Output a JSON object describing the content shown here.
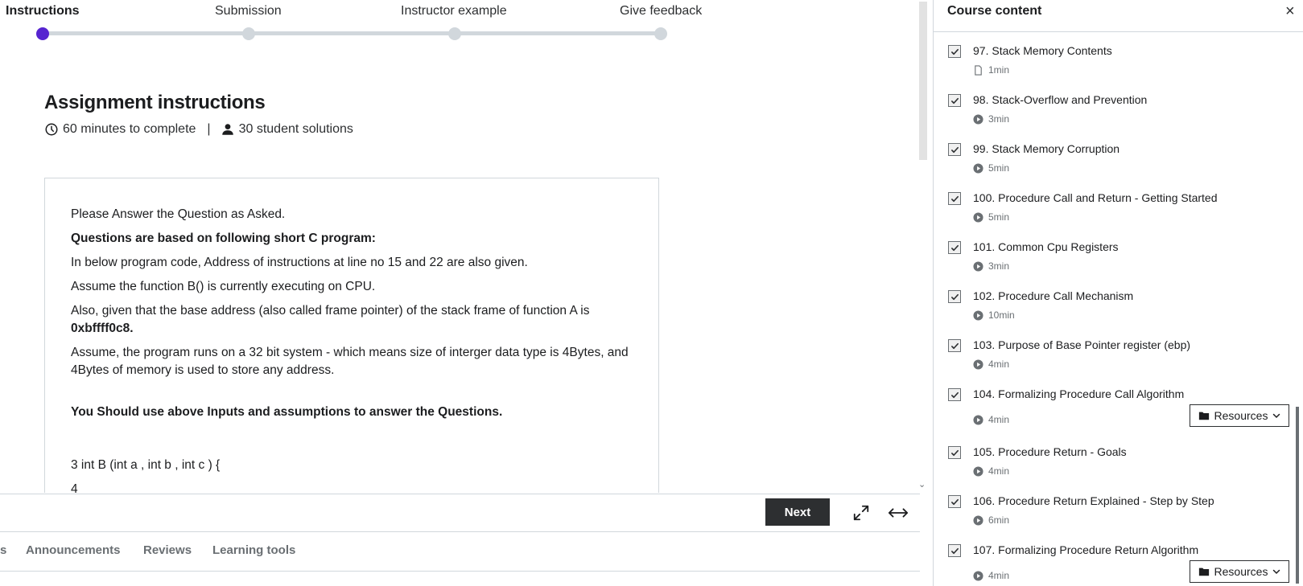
{
  "stepper": {
    "steps": [
      {
        "label": "Instructions",
        "active": true
      },
      {
        "label": "Submission",
        "active": false
      },
      {
        "label": "Instructor example",
        "active": false
      },
      {
        "label": "Give feedback",
        "active": false
      }
    ]
  },
  "assignment": {
    "title": "Assignment instructions",
    "duration": "60 minutes to complete",
    "separator": "|",
    "solutions": "30 student solutions"
  },
  "instructions": {
    "p1": "Please Answer the Question as Asked.",
    "p2": "Questions are based on following short C program:",
    "p3": "In below program code, Address of instructions at line no 15 and 22 are also given.",
    "p4": "Assume the function B() is currently executing on CPU.",
    "p5a": "Also, given that the base address (also called frame pointer) of the stack frame of function A is",
    "p5b": "0xbffff0c8.",
    "p6": "Assume, the program runs on a 32 bit system - which means size of interger data type is 4Bytes, and 4Bytes of memory is used to store any address.",
    "p7": "You Should use above Inputs and assumptions to answer the Questions.",
    "code1": "3 int B (int a , int b , int c ) {",
    "code2": "4"
  },
  "controls": {
    "next_label": "Next",
    "expand_icon": "expand-icon",
    "wide_icon": "horizontal-arrows-icon"
  },
  "tabs": [
    {
      "label": "s"
    },
    {
      "label": "Announcements"
    },
    {
      "label": "Reviews"
    },
    {
      "label": "Learning tools"
    }
  ],
  "sidebar": {
    "title": "Course content",
    "close_icon": "×",
    "resources_label": "Resources",
    "lectures": [
      {
        "title": "97. Stack Memory Contents",
        "duration": "1min",
        "type": "article"
      },
      {
        "title": "98. Stack-Overflow and Prevention",
        "duration": "3min",
        "type": "video"
      },
      {
        "title": "99. Stack Memory Corruption",
        "duration": "5min",
        "type": "video"
      },
      {
        "title": "100. Procedure Call and Return - Getting Started",
        "duration": "5min",
        "type": "video"
      },
      {
        "title": "101. Common Cpu Registers",
        "duration": "3min",
        "type": "video"
      },
      {
        "title": "102. Procedure Call Mechanism",
        "duration": "10min",
        "type": "video"
      },
      {
        "title": "103. Purpose of Base Pointer register (ebp)",
        "duration": "4min",
        "type": "video"
      },
      {
        "title": "104. Formalizing Procedure Call Algorithm",
        "duration": "4min",
        "type": "video",
        "resources": true
      },
      {
        "title": "105. Procedure Return - Goals",
        "duration": "4min",
        "type": "video"
      },
      {
        "title": "106. Procedure Return Explained - Step by Step",
        "duration": "6min",
        "type": "video"
      },
      {
        "title": "107. Formalizing Procedure Return Algorithm",
        "duration": "4min",
        "type": "video",
        "resources": true
      }
    ]
  },
  "colors": {
    "accent": "#5624d0",
    "dark": "#2d2f31",
    "border": "#d1d7dc"
  }
}
